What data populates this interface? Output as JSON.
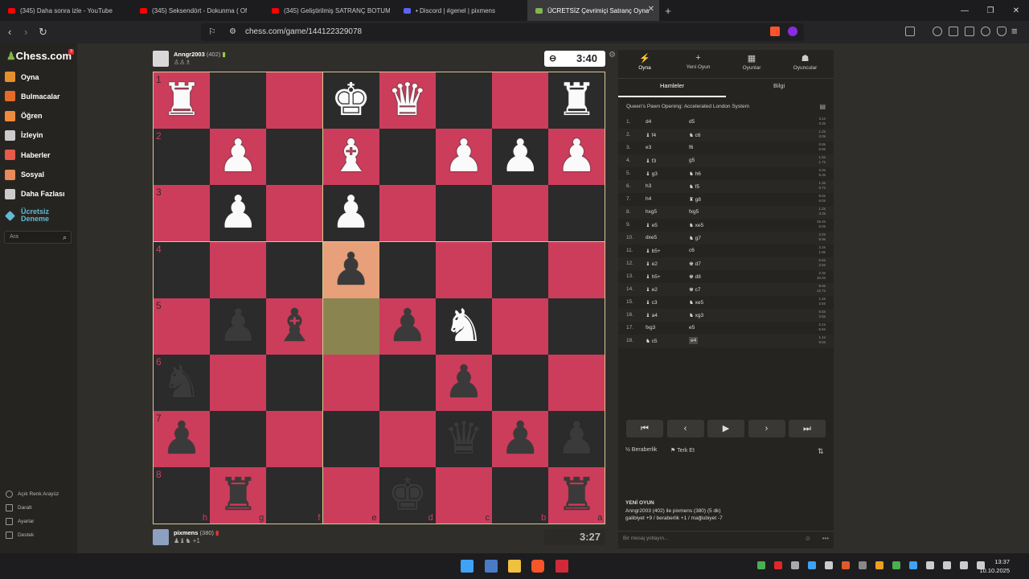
{
  "browser": {
    "tabs": [
      {
        "title": "(345) Daha sonra izle - YouTube",
        "color": "#ff0000"
      },
      {
        "title": "(345) Seksendört - Dokunma ( Of",
        "color": "#ff0000"
      },
      {
        "title": "(345) Geliştirilmiş SATRANÇ BOTUM",
        "color": "#ff0000"
      },
      {
        "title": "• Discord | #genel | pixmens",
        "color": "#5865f2"
      },
      {
        "title": "ÜCRETSİZ Çevrimiçi Satranç Oyna",
        "color": "#81b64c"
      }
    ],
    "new_tab": "+",
    "url": "chess.com/game/144122329078"
  },
  "sidebar": {
    "logo": "Chess.com",
    "notif": "3",
    "items": [
      {
        "label": "Oyna",
        "color": "#e58f2a"
      },
      {
        "label": "Bulmacalar",
        "color": "#e56b2a"
      },
      {
        "label": "Öğren",
        "color": "#ef8b3c"
      },
      {
        "label": "İzleyin",
        "color": "#cccccc"
      },
      {
        "label": "Haberler",
        "color": "#e85a4a"
      },
      {
        "label": "Sosyal",
        "color": "#e88a5a"
      },
      {
        "label": "Daha Fazlası",
        "color": "#cccccc"
      }
    ],
    "trial": "Ücretsiz Deneme",
    "search_placeholder": "Ara",
    "footer": [
      "Açık Renk Arayüz",
      "Daralt",
      "Ayarlar",
      "Destek"
    ]
  },
  "top_player": {
    "name": "Anngr2003",
    "rating": "(402)",
    "clock": "3:40"
  },
  "bottom_player": {
    "name": "pixmens",
    "rating": "(380)",
    "captured": "+1",
    "clock": "3:27"
  },
  "board": {
    "light": "#cc3d5c",
    "dark": "#2b2b2b",
    "ranks": [
      "1",
      "2",
      "3",
      "4",
      "5",
      "6",
      "7",
      "8"
    ],
    "files": [
      "h",
      "g",
      "f",
      "e",
      "d",
      "c",
      "b",
      "a"
    ],
    "pieces": [
      {
        "sq": "h1",
        "p": "♜",
        "c": "w"
      },
      {
        "sq": "e1",
        "p": "♚",
        "c": "w"
      },
      {
        "sq": "d1",
        "p": "♛",
        "c": "w"
      },
      {
        "sq": "a1",
        "p": "♜",
        "c": "w"
      },
      {
        "sq": "g2",
        "p": "♟",
        "c": "w"
      },
      {
        "sq": "e2",
        "p": "♝",
        "c": "w"
      },
      {
        "sq": "c2",
        "p": "♟",
        "c": "w"
      },
      {
        "sq": "b2",
        "p": "♟",
        "c": "w"
      },
      {
        "sq": "a2",
        "p": "♟",
        "c": "w"
      },
      {
        "sq": "g3",
        "p": "♟",
        "c": "w"
      },
      {
        "sq": "e3",
        "p": "♟",
        "c": "w"
      },
      {
        "sq": "e4",
        "p": "♟",
        "c": "b"
      },
      {
        "sq": "g5",
        "p": "♟",
        "c": "b"
      },
      {
        "sq": "f5",
        "p": "♝",
        "c": "b"
      },
      {
        "sq": "d5",
        "p": "♟",
        "c": "b"
      },
      {
        "sq": "c5",
        "p": "♞",
        "c": "w"
      },
      {
        "sq": "h6",
        "p": "♞",
        "c": "b"
      },
      {
        "sq": "c6",
        "p": "♟",
        "c": "b"
      },
      {
        "sq": "h7",
        "p": "♟",
        "c": "b"
      },
      {
        "sq": "c7",
        "p": "♛",
        "c": "b"
      },
      {
        "sq": "b7",
        "p": "♟",
        "c": "b"
      },
      {
        "sq": "a7",
        "p": "♟",
        "c": "b"
      },
      {
        "sq": "g8",
        "p": "♜",
        "c": "b"
      },
      {
        "sq": "d8",
        "p": "♚",
        "c": "b"
      },
      {
        "sq": "a8",
        "p": "♜",
        "c": "b"
      }
    ],
    "highlights": [
      {
        "sq": "e4",
        "color": "#e8a07a"
      },
      {
        "sq": "e5",
        "color": "#8a8450"
      }
    ]
  },
  "panel": {
    "tabs": [
      {
        "label": "Oyna",
        "icon": "⚡"
      },
      {
        "label": "Yeni Oyun",
        "icon": "+"
      },
      {
        "label": "Oyunlar",
        "icon": "▦"
      },
      {
        "label": "Oyuncular",
        "icon": "☗"
      }
    ],
    "subtabs": [
      "Hamleler",
      "Bilgi"
    ],
    "opening": "Queen's Pawn Opening: Accelerated London System",
    "moves": [
      {
        "n": "1.",
        "w": "d4",
        "b": "d5",
        "t": [
          "3.1s",
          "3.3s"
        ]
      },
      {
        "n": "2.",
        "w": "♝ f4",
        "b": "♞ c6",
        "t": [
          "1.2s",
          "2.0s"
        ]
      },
      {
        "n": "3.",
        "w": "e3",
        "b": "f6",
        "t": [
          "0.8s",
          "5.9s"
        ]
      },
      {
        "n": "4.",
        "w": "♝ f3",
        "b": "g5",
        "t": [
          "1.5s",
          "1.7s"
        ]
      },
      {
        "n": "5.",
        "w": "♝ g3",
        "b": "♞ h6",
        "t": [
          "2.0s",
          "5.3s"
        ]
      },
      {
        "n": "6.",
        "w": "h3",
        "b": "♞ f5",
        "t": [
          "1.3s",
          "0.7s"
        ]
      },
      {
        "n": "7.",
        "w": "h4",
        "b": "♜ g8",
        "t": [
          "6.6s",
          "6.0s"
        ]
      },
      {
        "n": "8.",
        "w": "hxg5",
        "b": "fxg5",
        "t": [
          "1.2s",
          "3.3s"
        ]
      },
      {
        "n": "9.",
        "w": "♝ e5",
        "b": "♞ xe5",
        "t": [
          "15.4s",
          "6.0s"
        ]
      },
      {
        "n": "10.",
        "w": "dxe5",
        "b": "♞ g7",
        "t": [
          "4.2s",
          "5.9s"
        ]
      },
      {
        "n": "11.",
        "w": "♝ b5+",
        "b": "c6",
        "t": [
          "2.2s",
          "1.9s"
        ]
      },
      {
        "n": "12.",
        "w": "♝ e2",
        "b": "♚ d7",
        "t": [
          "6.6s",
          "2.5s"
        ]
      },
      {
        "n": "13.",
        "w": "♝ h5+",
        "b": "♚ d8",
        "t": [
          "2.3s",
          "10.4s"
        ]
      },
      {
        "n": "14.",
        "w": "♝ e2",
        "b": "♚ c7",
        "t": [
          "9.8s",
          "12.7s"
        ]
      },
      {
        "n": "15.",
        "w": "♝ c3",
        "b": "♞ xe5",
        "t": [
          "1.4s",
          "2.5s"
        ]
      },
      {
        "n": "16.",
        "w": "♝ a4",
        "b": "♞ xg3",
        "t": [
          "6.5s",
          "2.6s"
        ]
      },
      {
        "n": "17.",
        "w": "fxg3",
        "b": "e5",
        "t": [
          "2.1s",
          "6.5s"
        ]
      },
      {
        "n": "18.",
        "w": "♞ c5",
        "b": "e4",
        "t": [
          "1.1s",
          "5.6s"
        ]
      }
    ],
    "controls": [
      "⏮",
      "‹",
      "▶",
      "›",
      "⏭"
    ],
    "draw": "Beraberlik",
    "resign": "Terk Et",
    "new_game": {
      "title": "YENİ OYUN",
      "line1": "Anngr2003 (402) ile pixmens (380) (5 dk)",
      "line2": "galibiyet +9 / beraberlik +1 / mağlubiyet -7"
    },
    "message_placeholder": "Bir mesaj yollayın..."
  },
  "taskbar": {
    "time": "13:37",
    "date": "10.10.2025"
  }
}
